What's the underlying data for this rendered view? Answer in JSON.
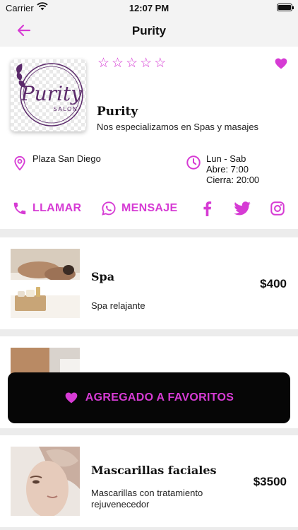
{
  "status_bar": {
    "carrier": "Carrier",
    "time": "12:07 PM"
  },
  "nav": {
    "title": "Purity"
  },
  "business": {
    "logo_text": "Purity",
    "logo_sub": "SALON",
    "rating": 0,
    "rating_max": 5,
    "favorite": true,
    "name": "Purity",
    "description": "Nos especializamos en Spas y masajes",
    "location": "Plaza San Diego",
    "hours": {
      "days": "Lun - Sab",
      "open": "Abre: 7:00",
      "close": "Cierra: 20:00"
    }
  },
  "actions": {
    "call": "LLAMAR",
    "message": "MENSAJE"
  },
  "services": [
    {
      "name": "Spa",
      "description": "Spa relajante",
      "price": "$400"
    },
    {
      "name": "",
      "description": "",
      "price": ""
    },
    {
      "name": "Mascarillas faciales",
      "description": "Mascarillas con tratamiento rejuvenecedor",
      "price": "$3500"
    }
  ],
  "toast": {
    "text": "AGREGADO A FAVORITOS"
  },
  "colors": {
    "accent": "#d63bd4",
    "toast_bg": "#060606",
    "page_bg": "#ececec"
  }
}
